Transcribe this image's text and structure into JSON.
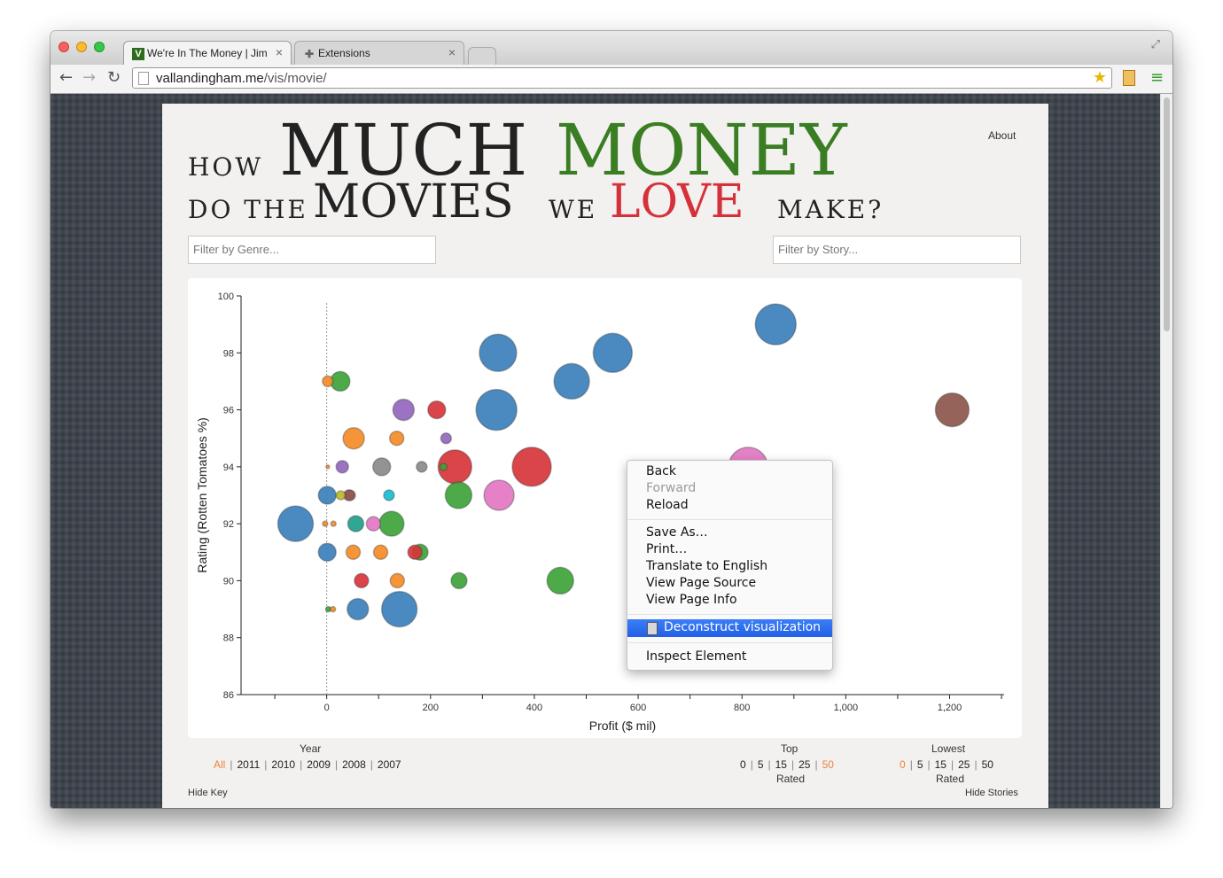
{
  "browser": {
    "tabs": [
      {
        "title": "We're In The Money | Jim V",
        "favicon": "V",
        "active": true
      },
      {
        "title": "Extensions",
        "favicon": "puzzle-icon",
        "active": false
      }
    ],
    "url_host": "vallandingham.me",
    "url_path": "/vis/movie/"
  },
  "page": {
    "headline": {
      "how": "HOW",
      "much": "MUCH",
      "money": "MONEY",
      "do_the": "DO THE",
      "movies": "MOVIES",
      "we": "WE",
      "love": "LOVE",
      "make": "MAKE?"
    },
    "colors": {
      "money": "#3a7d22",
      "love": "#d6303a",
      "selected": "#f08040"
    },
    "about_link": "About",
    "filters": {
      "genre_placeholder": "Filter by Genre...",
      "story_placeholder": "Filter by Story..."
    },
    "bottom": {
      "year_label": "Year",
      "years": [
        "All",
        "2011",
        "2010",
        "2009",
        "2008",
        "2007"
      ],
      "year_selected": "All",
      "top_label": "Top",
      "top_options": [
        "0",
        "5",
        "15",
        "25",
        "50"
      ],
      "top_selected": "50",
      "lowest_label": "Lowest",
      "lowest_options": [
        "0",
        "5",
        "15",
        "25",
        "50"
      ],
      "lowest_selected": "0",
      "rated_label": "Rated",
      "hide_key": "Hide Key",
      "hide_stories": "Hide Stories"
    }
  },
  "context_menu": {
    "items": [
      {
        "label": "Back",
        "enabled": true
      },
      {
        "label": "Forward",
        "enabled": false
      },
      {
        "label": "Reload",
        "enabled": true
      },
      {
        "label": "Save As…",
        "enabled": true
      },
      {
        "label": "Print…",
        "enabled": true
      },
      {
        "label": "Translate to English",
        "enabled": true
      },
      {
        "label": "View Page Source",
        "enabled": true
      },
      {
        "label": "View Page Info",
        "enabled": true
      },
      {
        "label": "Deconstruct visualization",
        "enabled": true,
        "highlighted": true
      },
      {
        "label": "Inspect Element",
        "enabled": true
      }
    ]
  },
  "chart_data": {
    "type": "scatter",
    "xlabel": "Profit ($ mil)",
    "ylabel": "Rating (Rotten Tomatoes %)",
    "xlim": [
      -165,
      1305
    ],
    "ylim": [
      86,
      100
    ],
    "xticks": [
      0,
      200,
      400,
      600,
      800,
      1000,
      1200
    ],
    "xtick_labels": [
      "0",
      "200",
      "400",
      "600",
      "800",
      "1,000",
      "1,200"
    ],
    "yticks": [
      86,
      88,
      90,
      92,
      94,
      96,
      98,
      100
    ],
    "genre_colors": {
      "blue": "#3b80bb",
      "green": "#3da33a",
      "red": "#d6353a",
      "orange": "#f58c26",
      "purple": "#9467bd",
      "brown": "#8c564b",
      "pink": "#e377c2",
      "gray": "#8a8a8a",
      "olive": "#bcbd22",
      "teal": "#17becf",
      "darkteal": "#1f9e89"
    },
    "points": [
      {
        "x": 865,
        "y": 99,
        "size": 23,
        "color": "blue"
      },
      {
        "x": 330,
        "y": 98,
        "size": 21,
        "color": "blue"
      },
      {
        "x": 551,
        "y": 98,
        "size": 22,
        "color": "blue"
      },
      {
        "x": 472,
        "y": 97,
        "size": 20,
        "color": "blue"
      },
      {
        "x": 2,
        "y": 97,
        "size": 6,
        "color": "orange"
      },
      {
        "x": 26,
        "y": 97,
        "size": 11,
        "color": "green"
      },
      {
        "x": 327,
        "y": 96,
        "size": 23,
        "color": "blue"
      },
      {
        "x": 148,
        "y": 96,
        "size": 12,
        "color": "purple"
      },
      {
        "x": 212,
        "y": 96,
        "size": 10,
        "color": "red"
      },
      {
        "x": 1205,
        "y": 96,
        "size": 19,
        "color": "brown"
      },
      {
        "x": 52,
        "y": 95,
        "size": 12,
        "color": "orange"
      },
      {
        "x": 135,
        "y": 95,
        "size": 8,
        "color": "orange"
      },
      {
        "x": 230,
        "y": 95,
        "size": 6,
        "color": "purple"
      },
      {
        "x": 2,
        "y": 94,
        "size": 2,
        "color": "orange"
      },
      {
        "x": 30,
        "y": 94,
        "size": 7,
        "color": "purple"
      },
      {
        "x": 106,
        "y": 94,
        "size": 10,
        "color": "gray"
      },
      {
        "x": 183,
        "y": 94,
        "size": 6,
        "color": "gray"
      },
      {
        "x": 395,
        "y": 94,
        "size": 22,
        "color": "red"
      },
      {
        "x": 247,
        "y": 94,
        "size": 19,
        "color": "red"
      },
      {
        "x": 225,
        "y": 94,
        "size": 4,
        "color": "green"
      },
      {
        "x": 812,
        "y": 94,
        "size": 22,
        "color": "pink"
      },
      {
        "x": 1,
        "y": 93,
        "size": 10,
        "color": "blue"
      },
      {
        "x": 27,
        "y": 93,
        "size": 5,
        "color": "olive"
      },
      {
        "x": 42,
        "y": 93,
        "size": 6,
        "color": "pink"
      },
      {
        "x": 45,
        "y": 93,
        "size": 6,
        "color": "brown"
      },
      {
        "x": 120,
        "y": 93,
        "size": 6,
        "color": "teal"
      },
      {
        "x": 254,
        "y": 93,
        "size": 15,
        "color": "green"
      },
      {
        "x": 332,
        "y": 93,
        "size": 17,
        "color": "pink"
      },
      {
        "x": -60,
        "y": 92,
        "size": 20,
        "color": "blue"
      },
      {
        "x": -3,
        "y": 92,
        "size": 3,
        "color": "orange"
      },
      {
        "x": 13,
        "y": 92,
        "size": 3,
        "color": "orange"
      },
      {
        "x": 56,
        "y": 92,
        "size": 9,
        "color": "darkteal"
      },
      {
        "x": 90,
        "y": 92,
        "size": 8,
        "color": "pink"
      },
      {
        "x": 125,
        "y": 92,
        "size": 14,
        "color": "green"
      },
      {
        "x": 1,
        "y": 91,
        "size": 10,
        "color": "blue"
      },
      {
        "x": 51,
        "y": 91,
        "size": 8,
        "color": "orange"
      },
      {
        "x": 104,
        "y": 91,
        "size": 8,
        "color": "orange"
      },
      {
        "x": 170,
        "y": 91,
        "size": 8,
        "color": "red"
      },
      {
        "x": 180,
        "y": 91,
        "size": 9,
        "color": "green"
      },
      {
        "x": 67,
        "y": 90,
        "size": 8,
        "color": "red"
      },
      {
        "x": 136,
        "y": 90,
        "size": 8,
        "color": "orange"
      },
      {
        "x": 255,
        "y": 90,
        "size": 9,
        "color": "green"
      },
      {
        "x": 450,
        "y": 90,
        "size": 15,
        "color": "green"
      },
      {
        "x": 3,
        "y": 89,
        "size": 3,
        "color": "green"
      },
      {
        "x": 12,
        "y": 89,
        "size": 3,
        "color": "orange"
      },
      {
        "x": 60,
        "y": 89,
        "size": 12,
        "color": "blue"
      },
      {
        "x": 140,
        "y": 89,
        "size": 20,
        "color": "blue"
      }
    ]
  }
}
